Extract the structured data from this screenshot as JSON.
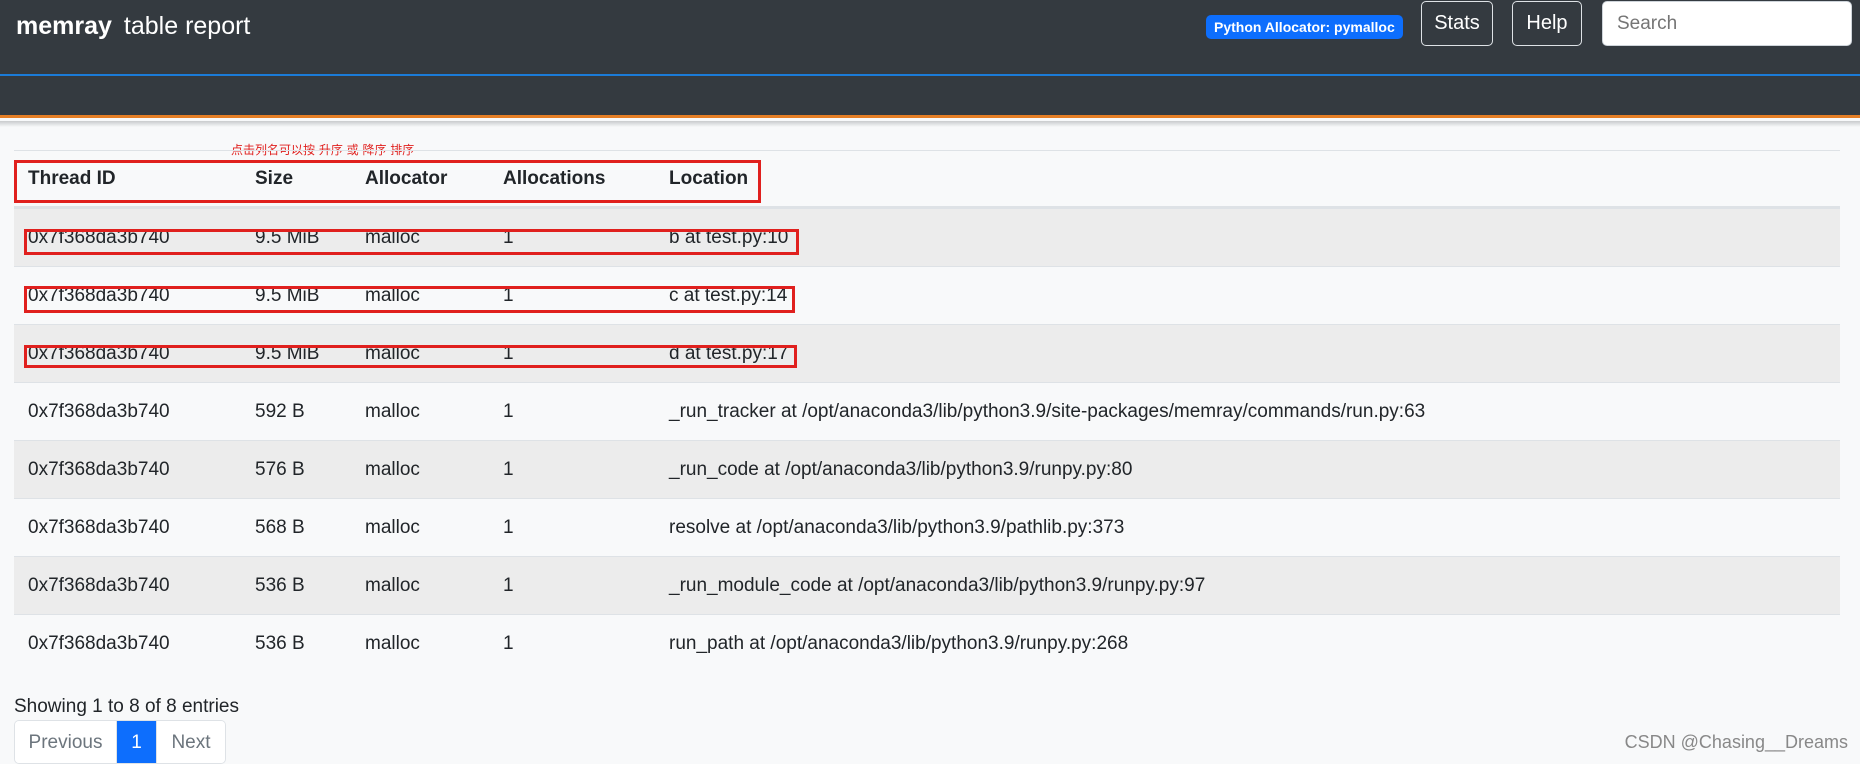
{
  "navbar": {
    "brand_bold": "memray",
    "brand_light": "table report",
    "allocator_badge": "Python Allocator: pymalloc",
    "stats_label": "Stats",
    "help_label": "Help",
    "search_placeholder": "Search"
  },
  "annotation": "点击列名可以按 升序 或 降序 排序",
  "table": {
    "columns": [
      "Thread ID",
      "Size",
      "Allocator",
      "Allocations",
      "Location"
    ],
    "rows": [
      [
        "0x7f368da3b740",
        "9.5 MiB",
        "malloc",
        "1",
        "b at test.py:10"
      ],
      [
        "0x7f368da3b740",
        "9.5 MiB",
        "malloc",
        "1",
        "c at test.py:14"
      ],
      [
        "0x7f368da3b740",
        "9.5 MiB",
        "malloc",
        "1",
        "d at test.py:17"
      ],
      [
        "0x7f368da3b740",
        "592 B",
        "malloc",
        "1",
        "_run_tracker at /opt/anaconda3/lib/python3.9/site-packages/memray/commands/run.py:63"
      ],
      [
        "0x7f368da3b740",
        "576 B",
        "malloc",
        "1",
        "_run_code at /opt/anaconda3/lib/python3.9/runpy.py:80"
      ],
      [
        "0x7f368da3b740",
        "568 B",
        "malloc",
        "1",
        "resolve at /opt/anaconda3/lib/python3.9/pathlib.py:373"
      ],
      [
        "0x7f368da3b740",
        "536 B",
        "malloc",
        "1",
        "_run_module_code at /opt/anaconda3/lib/python3.9/runpy.py:97"
      ],
      [
        "0x7f368da3b740",
        "536 B",
        "malloc",
        "1",
        "run_path at /opt/anaconda3/lib/python3.9/runpy.py:268"
      ]
    ]
  },
  "footer": {
    "entries_info": "Showing 1 to 8 of 8 entries",
    "prev_label": "Previous",
    "page_label": "1",
    "next_label": "Next"
  },
  "watermark": "CSDN @Chasing__Dreams",
  "colors": {
    "navbar": "#343a40",
    "badge": "#0d6efd",
    "accent_line": "#e57e25",
    "highlight_box": "#e0201e"
  }
}
